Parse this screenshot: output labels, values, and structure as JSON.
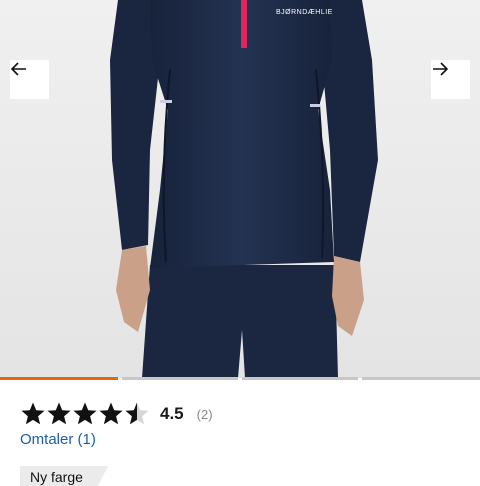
{
  "gallery": {
    "brand_logo": "BJØRNDÆHLIE",
    "prev_icon": "arrow-left-icon",
    "next_icon": "arrow-right-icon",
    "slide_count": 4,
    "active_slide": 1
  },
  "rating": {
    "value": "4.5",
    "stars_filled": 4.5,
    "stars_total": 5,
    "count": "(2)"
  },
  "reviews_link": "Omtaler (1)",
  "badge": "Ny farge",
  "colors": {
    "accent": "#e8650a",
    "link": "#1a5fa8",
    "garment": "#1e2b45",
    "zipper": "#e0245e"
  }
}
